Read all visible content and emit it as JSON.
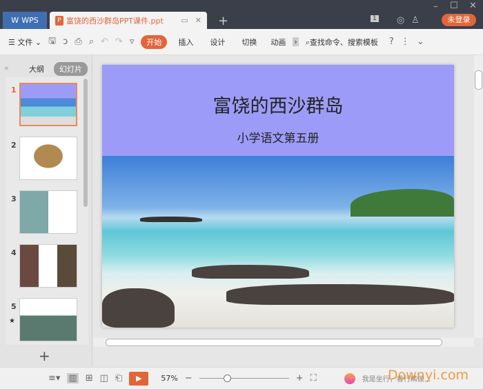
{
  "titlebar": {
    "app_tab": "WPS",
    "doc_tab": "富饶的西沙群岛PPT课件.ppt",
    "new_tab": "+",
    "login": "未登录",
    "badge": "1"
  },
  "toolbar": {
    "file": "文件",
    "start": "开始",
    "insert": "插入",
    "design": "设计",
    "transition": "切换",
    "animation": "动画",
    "search": "查找命令、搜索模板",
    "help": "?"
  },
  "sidebar": {
    "outline": "大纲",
    "slides": "幻灯片",
    "add": "+",
    "thumbs": [
      {
        "n": "1"
      },
      {
        "n": "2"
      },
      {
        "n": "3"
      },
      {
        "n": "4"
      },
      {
        "n": "5"
      }
    ]
  },
  "slide": {
    "title": "富饶的西沙群岛",
    "subtitle": "小学语文第五册"
  },
  "statusbar": {
    "zoom": "57%",
    "zoom_fraction": 0.3,
    "watermark": "Downyi.com",
    "assistant": "我是坐行，看行精做..."
  },
  "colors": {
    "accent": "#e0663a",
    "slide_header": "#9c9cf8"
  }
}
